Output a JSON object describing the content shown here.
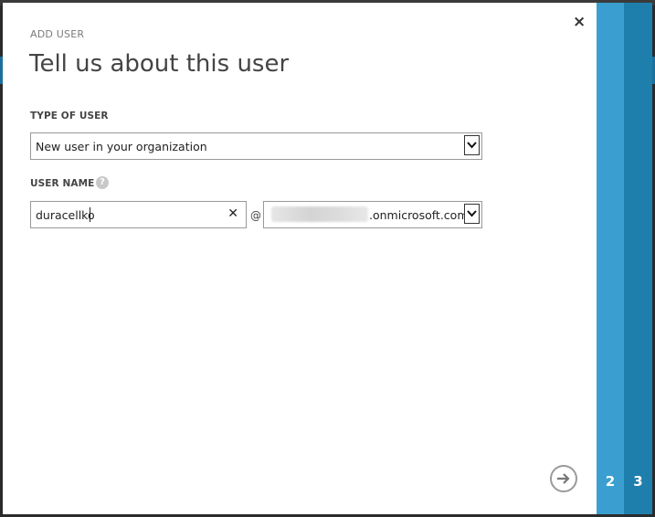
{
  "dialog": {
    "eyebrow": "ADD USER",
    "title": "Tell us about this user",
    "close_symbol": "×"
  },
  "type_of_user": {
    "label": "TYPE OF USER",
    "selected": "New user in your organization"
  },
  "user_name": {
    "label": "USER NAME",
    "help_symbol": "?",
    "value": "duracellko",
    "clear_symbol": "✕",
    "at_symbol": "@",
    "domain_suffix": ".onmicrosoft.com"
  },
  "wizard": {
    "steps": [
      {
        "label": "2",
        "color": "#3a9fd0"
      },
      {
        "label": "3",
        "color": "#1e7fad"
      }
    ]
  },
  "icons": {
    "close": "close-icon",
    "help": "help-icon",
    "dropdown": "chevron-down-icon",
    "clear": "clear-icon",
    "next": "arrow-right-icon"
  }
}
